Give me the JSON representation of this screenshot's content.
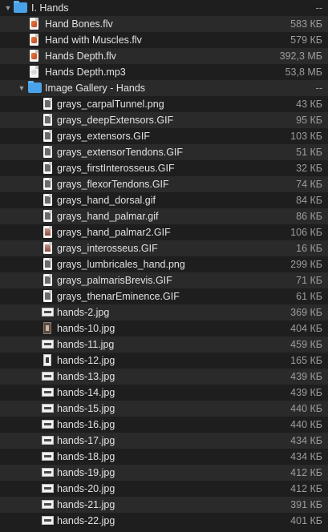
{
  "root_folder": {
    "name": "I. Hands",
    "size": "--",
    "disclosure": "▼",
    "icon": "folder-icon"
  },
  "files": [
    {
      "name": "Hand Bones.flv",
      "size": "583 КБ",
      "icon": "video-file-icon"
    },
    {
      "name": "Hand with Muscles.flv",
      "size": "579 КБ",
      "icon": "video-file-icon"
    },
    {
      "name": "Hands Depth.flv",
      "size": "392,3 МБ",
      "icon": "video-file-icon"
    },
    {
      "name": "Hands Depth.mp3",
      "size": "53,8 МБ",
      "icon": "audio-file-icon"
    }
  ],
  "gallery_folder": {
    "name": "Image Gallery - Hands",
    "size": "--",
    "disclosure": "▼",
    "icon": "folder-icon"
  },
  "gallery_items": [
    {
      "name": "grays_carpalTunnel.png",
      "size": "43 КБ",
      "icon": "image-portrait-icon"
    },
    {
      "name": "grays_deepExtensors.GIF",
      "size": "95 КБ",
      "icon": "image-portrait-icon"
    },
    {
      "name": "grays_extensors.GIF",
      "size": "103 КБ",
      "icon": "image-portrait-icon"
    },
    {
      "name": "grays_extensorTendons.GIF",
      "size": "51 КБ",
      "icon": "image-portrait-icon"
    },
    {
      "name": "grays_firstInterosseus.GIF",
      "size": "32 КБ",
      "icon": "image-portrait-icon"
    },
    {
      "name": "grays_flexorTendons.GIF",
      "size": "74 КБ",
      "icon": "image-portrait-icon"
    },
    {
      "name": "grays_hand_dorsal.gif",
      "size": "84 КБ",
      "icon": "image-portrait-icon"
    },
    {
      "name": "grays_hand_palmar.gif",
      "size": "86 КБ",
      "icon": "image-portrait-icon"
    },
    {
      "name": "grays_hand_palmar2.GIF",
      "size": "106 КБ",
      "icon": "image-portrait-red-icon"
    },
    {
      "name": "grays_interosseus.GIF",
      "size": "16 КБ",
      "icon": "image-portrait-red-icon"
    },
    {
      "name": "grays_lumbricales_hand.png",
      "size": "299 КБ",
      "icon": "image-portrait-icon"
    },
    {
      "name": "grays_palmarisBrevis.GIF",
      "size": "71 КБ",
      "icon": "image-portrait-icon"
    },
    {
      "name": "grays_thenarEminence.GIF",
      "size": "61 КБ",
      "icon": "image-portrait-icon"
    },
    {
      "name": "hands-2.jpg",
      "size": "369 КБ",
      "icon": "image-landscape-icon"
    },
    {
      "name": "hands-10.jpg",
      "size": "404 КБ",
      "icon": "image-portrait-dark-icon"
    },
    {
      "name": "hands-11.jpg",
      "size": "459 КБ",
      "icon": "image-landscape-icon"
    },
    {
      "name": "hands-12.jpg",
      "size": "165 КБ",
      "icon": "image-portrait-thumb-icon"
    },
    {
      "name": "hands-13.jpg",
      "size": "439 КБ",
      "icon": "image-landscape-icon"
    },
    {
      "name": "hands-14.jpg",
      "size": "439 КБ",
      "icon": "image-landscape-icon"
    },
    {
      "name": "hands-15.jpg",
      "size": "440 КБ",
      "icon": "image-landscape-icon"
    },
    {
      "name": "hands-16.jpg",
      "size": "440 КБ",
      "icon": "image-landscape-icon"
    },
    {
      "name": "hands-17.jpg",
      "size": "434 КБ",
      "icon": "image-landscape-icon"
    },
    {
      "name": "hands-18.jpg",
      "size": "434 КБ",
      "icon": "image-landscape-icon"
    },
    {
      "name": "hands-19.jpg",
      "size": "412 КБ",
      "icon": "image-landscape-icon"
    },
    {
      "name": "hands-20.jpg",
      "size": "412 КБ",
      "icon": "image-landscape-icon"
    },
    {
      "name": "hands-21.jpg",
      "size": "391 КБ",
      "icon": "image-landscape-icon"
    },
    {
      "name": "hands-22.jpg",
      "size": "401 КБ",
      "icon": "image-landscape-icon"
    }
  ]
}
